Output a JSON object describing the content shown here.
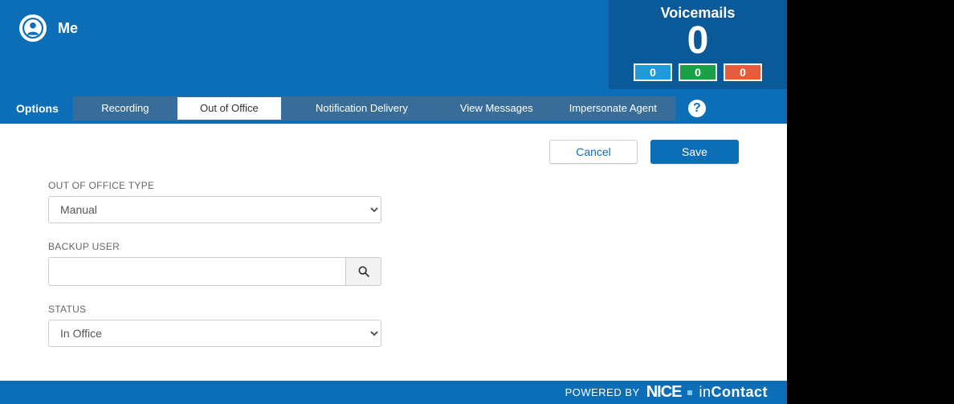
{
  "header": {
    "user_label": "Me"
  },
  "voicemails": {
    "title": "Voicemails",
    "total": "0",
    "badges": {
      "blue": "0",
      "green": "0",
      "red": "0"
    }
  },
  "tabs": {
    "options_label": "Options",
    "items": [
      {
        "label": "Recording",
        "active": false
      },
      {
        "label": "Out of Office",
        "active": true
      },
      {
        "label": "Notification Delivery",
        "active": false
      },
      {
        "label": "View Messages",
        "active": false
      },
      {
        "label": "Impersonate Agent",
        "active": false
      }
    ],
    "help": "?"
  },
  "actions": {
    "cancel": "Cancel",
    "save": "Save"
  },
  "form": {
    "ooo_type": {
      "label": "OUT OF OFFICE TYPE",
      "value": "Manual"
    },
    "backup_user": {
      "label": "BACKUP USER",
      "value": ""
    },
    "status": {
      "label": "STATUS",
      "value": "In Office"
    }
  },
  "footer": {
    "powered_by": "POWERED BY",
    "brand_nice": "NICE",
    "brand_in": "in",
    "brand_contact": "Contact"
  }
}
